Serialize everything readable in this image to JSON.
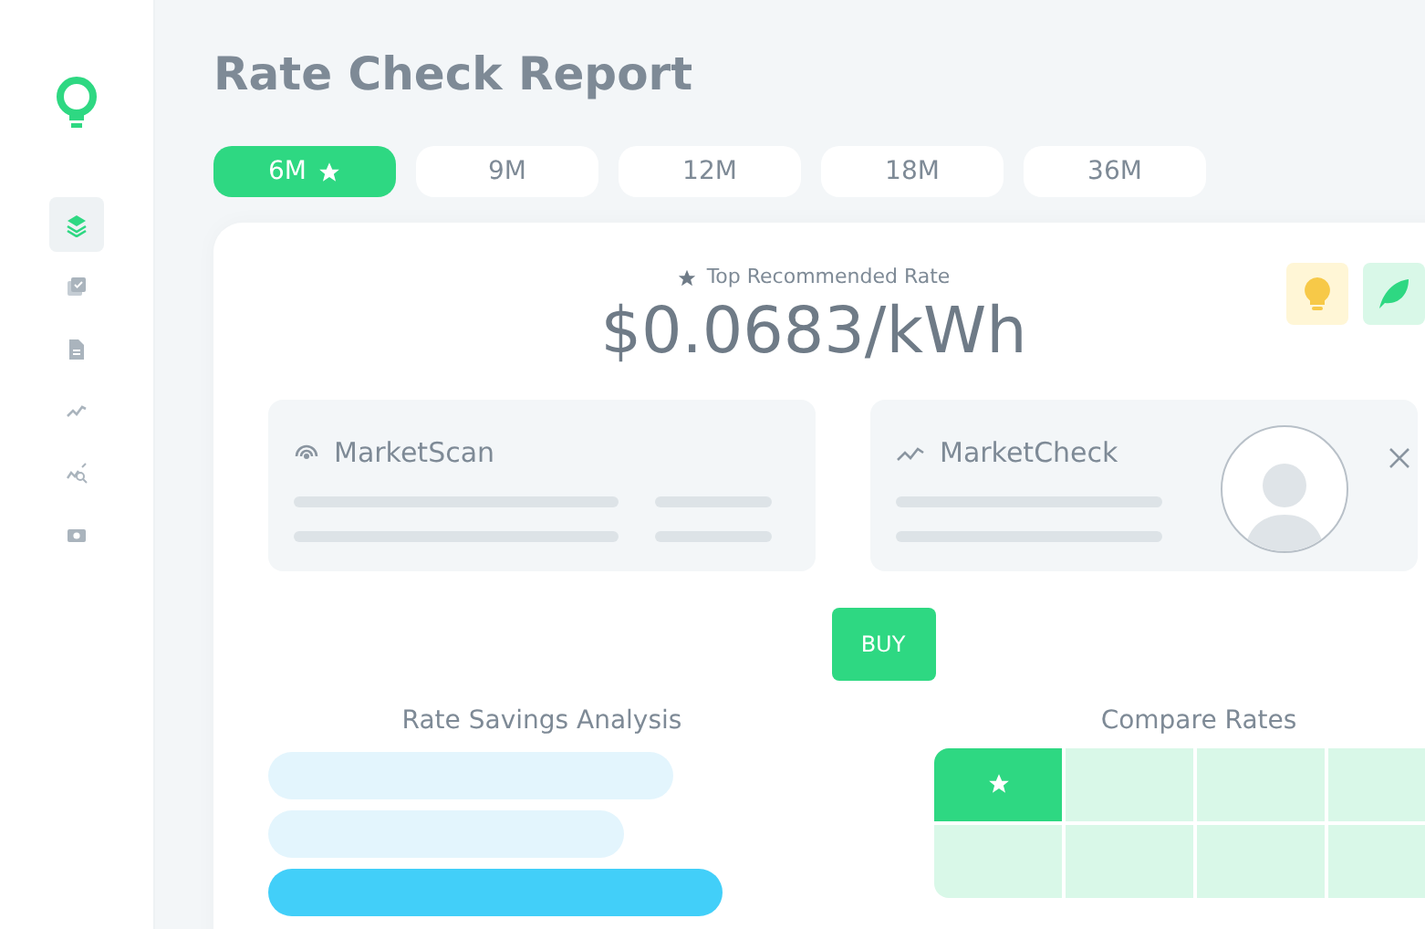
{
  "sidebar": {
    "items": [
      {
        "selected": true
      },
      {
        "selected": false
      },
      {
        "selected": false
      },
      {
        "selected": false
      },
      {
        "selected": false
      },
      {
        "selected": false
      }
    ]
  },
  "title": "Rate Check Report",
  "tabs": [
    {
      "label": "6M",
      "selected": true,
      "starred": true
    },
    {
      "label": "9M",
      "selected": false,
      "starred": false
    },
    {
      "label": "12M",
      "selected": false,
      "starred": false
    },
    {
      "label": "18M",
      "selected": false,
      "starred": false
    },
    {
      "label": "36M",
      "selected": false,
      "starred": false
    }
  ],
  "recommendation": {
    "caption": "Top Recommended Rate",
    "rate": "$0.0683/kWh"
  },
  "panels": [
    {
      "kind": "scan",
      "title": "MarketScan"
    },
    {
      "kind": "check",
      "title": "MarketCheck"
    }
  ],
  "buy_button": "BUY",
  "savings": {
    "title": "Rate Savings Analysis"
  },
  "compare": {
    "title": "Compare Rates",
    "rows": [
      {
        "cells": [
          {
            "selected": true
          },
          {
            "selected": false
          },
          {
            "selected": false
          },
          {
            "selected": false
          }
        ]
      },
      {
        "cells": [
          {
            "selected": false
          },
          {
            "selected": false
          },
          {
            "selected": false
          },
          {
            "selected": false
          }
        ]
      }
    ]
  }
}
